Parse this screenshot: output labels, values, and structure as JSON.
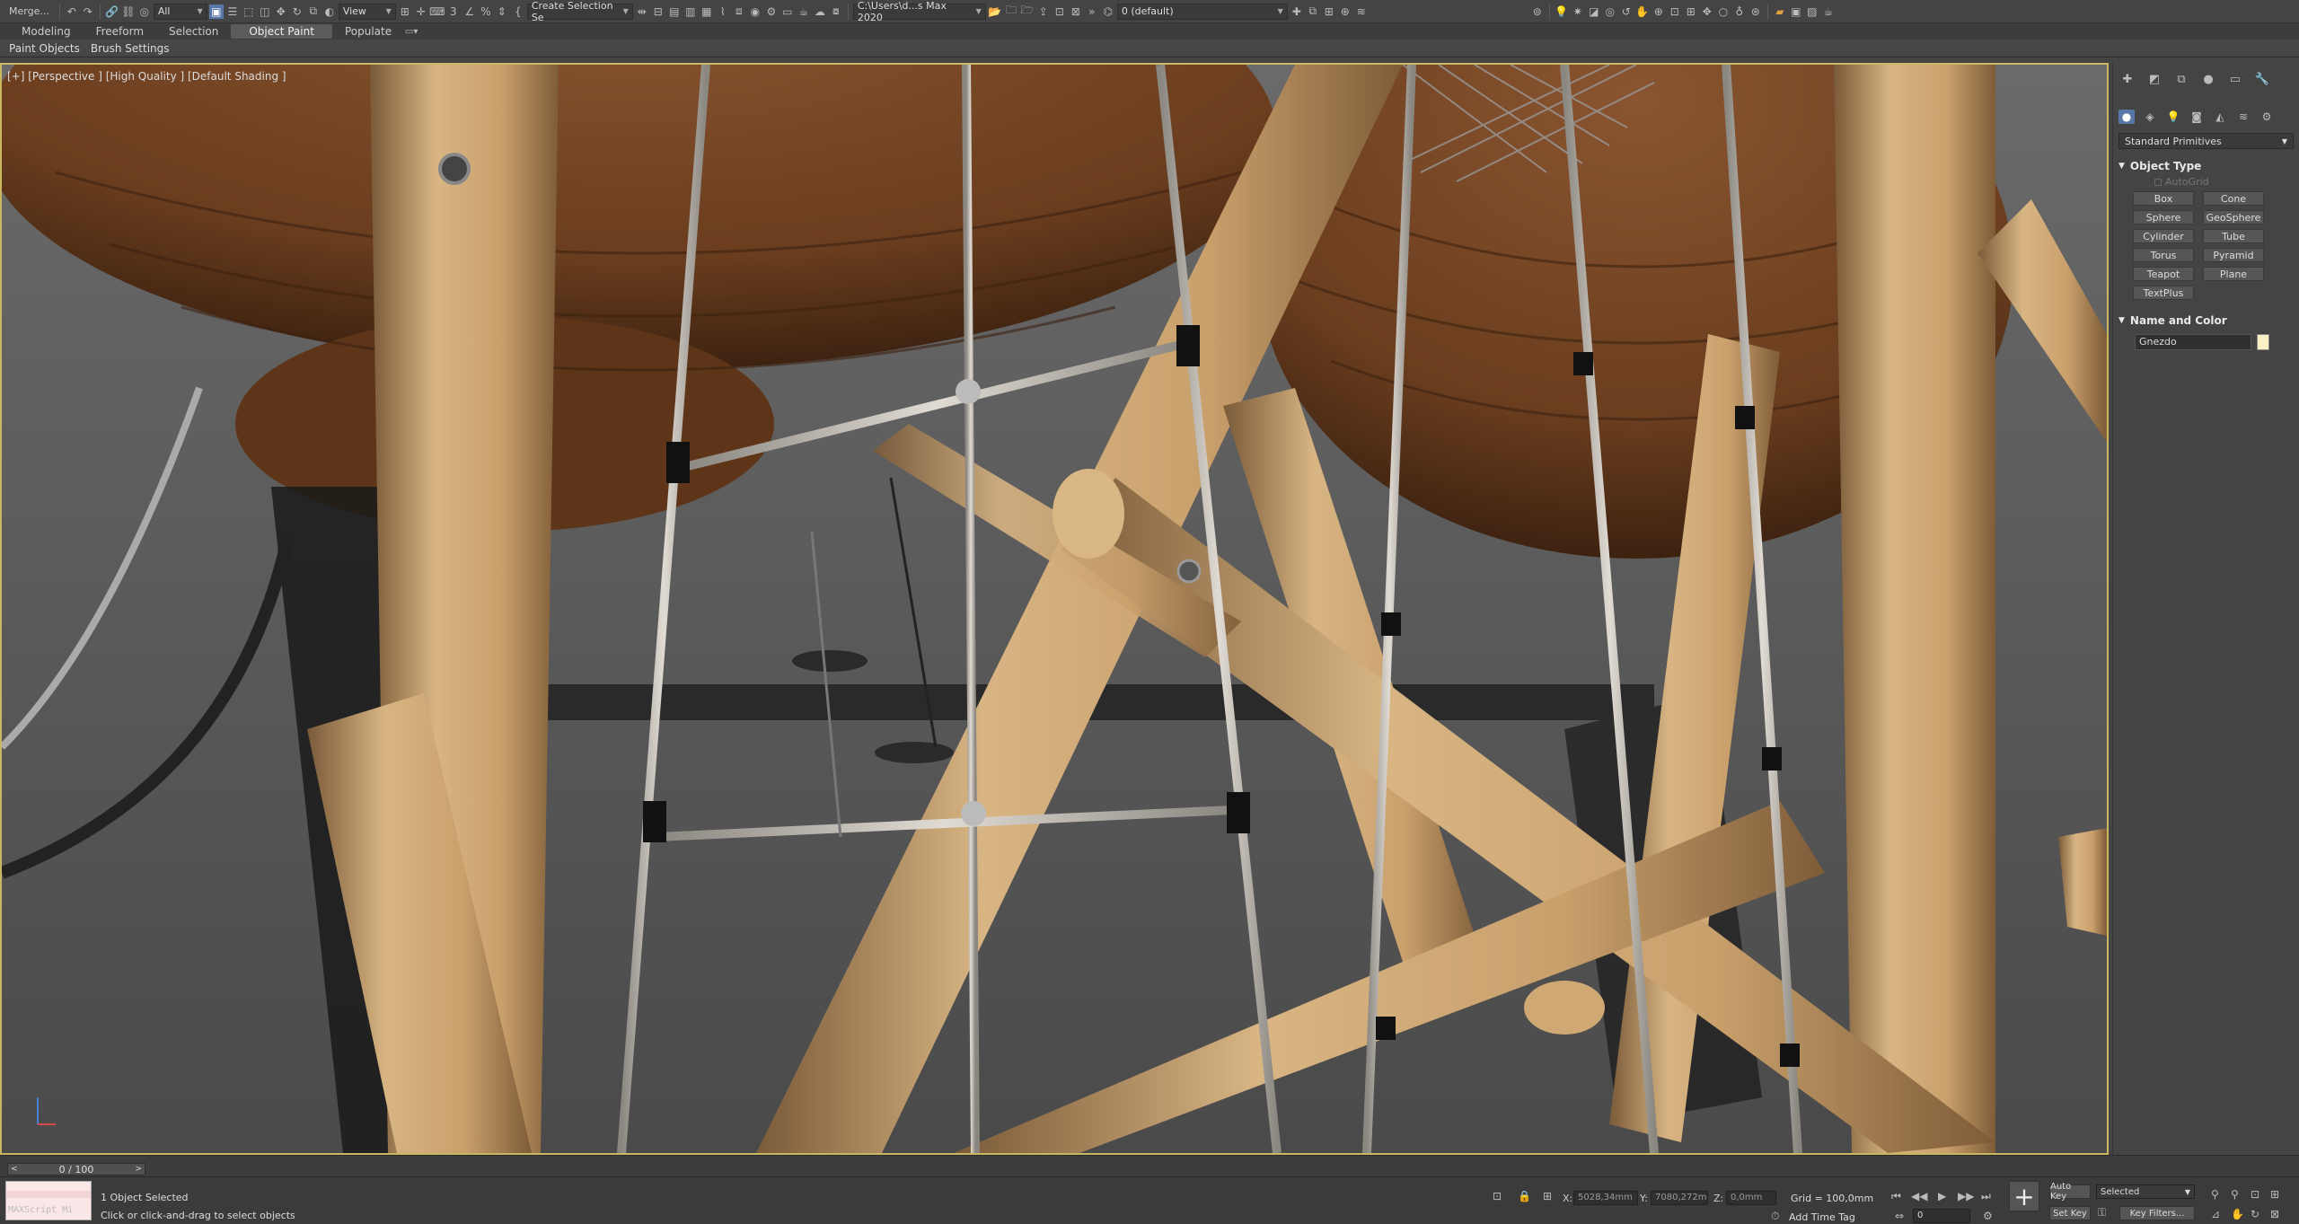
{
  "toolbar": {
    "merge_label": "Merge...",
    "selection_filter": "All",
    "ref_coord": "View",
    "named_selection": "Create Selection Se",
    "project_path": "C:\\Users\\d...s Max 2020",
    "layer": "0 (default)"
  },
  "ribbon": {
    "tabs": [
      "Modeling",
      "Freeform",
      "Selection",
      "Object Paint",
      "Populate"
    ],
    "active_tab": "Object Paint",
    "panels": [
      "Paint Objects",
      "Brush Settings"
    ]
  },
  "viewport": {
    "label": "[+] [Perspective ] [High Quality ] [Default Shading ]",
    "border_color": "#c9b860"
  },
  "command_panel": {
    "category": "Standard Primitives",
    "object_type_title": "Object Type",
    "autogrid_label": "AutoGrid",
    "primitives": [
      "Box",
      "Cone",
      "Sphere",
      "GeoSphere",
      "Cylinder",
      "Tube",
      "Torus",
      "Pyramid",
      "Teapot",
      "Plane",
      "TextPlus"
    ],
    "name_color_title": "Name and Color",
    "object_name": "Gnezdo",
    "object_color": "#fbf0c4"
  },
  "timeline": {
    "slider_label": "0 / 100"
  },
  "status": {
    "maxscript_label": "MAXScript Mi",
    "selection_info": "1 Object Selected",
    "prompt": "Click or click-and-drag to select objects",
    "x_label": "X:",
    "x_value": "5028,34mm",
    "y_label": "Y:",
    "y_value": "7080,272m",
    "z_label": "Z:",
    "z_value": "0,0mm",
    "grid": "Grid = 100,0mm",
    "add_time_tag": "Add Time Tag",
    "auto_key": "Auto Key",
    "set_key": "Set Key",
    "key_mode": "Selected",
    "key_filters": "Key Filters...",
    "frame": "0"
  }
}
